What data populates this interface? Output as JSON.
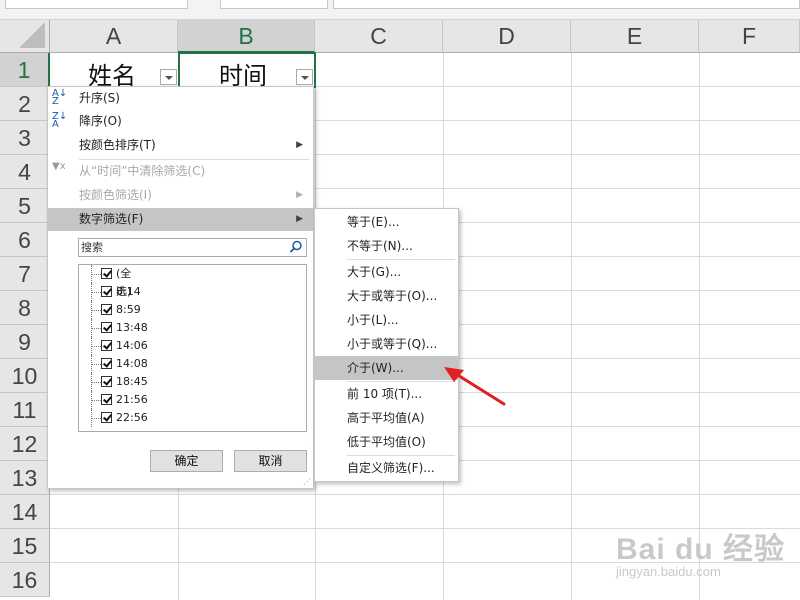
{
  "columns": [
    "A",
    "B",
    "C",
    "D",
    "E",
    "F"
  ],
  "rows": [
    "1",
    "2",
    "3",
    "4",
    "5",
    "6",
    "7",
    "8",
    "9",
    "10",
    "11",
    "12",
    "13",
    "14",
    "15",
    "16"
  ],
  "cells": {
    "a1": "姓名",
    "b1": "时间"
  },
  "filter_menu": {
    "sort_asc": "升序(S)",
    "sort_desc": "降序(O)",
    "sort_by_color": "按颜色排序(T)",
    "clear_filter": "从“时间”中清除筛选(C)",
    "filter_by_color": "按颜色筛选(I)",
    "number_filter": "数字筛选(F)",
    "search_placeholder": "搜索",
    "list_items": [
      "(全选)",
      "8:14",
      "8:59",
      "13:48",
      "14:06",
      "14:08",
      "18:45",
      "21:56",
      "22:56"
    ],
    "ok": "确定",
    "cancel": "取消"
  },
  "number_filter_submenu": {
    "items": [
      "等于(E)...",
      "不等于(N)...",
      "大于(G)...",
      "大于或等于(O)...",
      "小于(L)...",
      "小于或等于(Q)...",
      "介于(W)...",
      "前 10 项(T)...",
      "高于平均值(A)",
      "低于平均值(O)",
      "自定义筛选(F)..."
    ],
    "highlighted": "介于(W)..."
  },
  "colors": {
    "excel_green": "#217346",
    "annotation_arrow": "#e02020",
    "menu_highlight": "#c5c5c5"
  },
  "watermark": {
    "logo": "Bai du 经验",
    "site": "jingyan.baidu.com"
  }
}
